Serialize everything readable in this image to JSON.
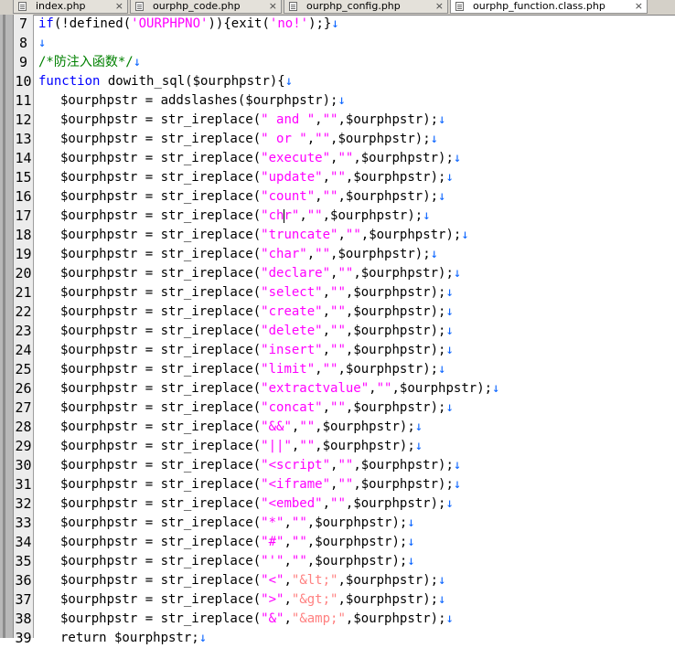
{
  "tabs": [
    {
      "label": "index.php",
      "active": false
    },
    {
      "label": "ourphp_code.php",
      "active": false
    },
    {
      "label": "ourphp_config.php",
      "active": false
    },
    {
      "label": "ourphp_function.class.php",
      "active": true
    }
  ],
  "tab_close_glyph": "×",
  "newline_glyph": "↓",
  "colors": {
    "keyword": "#0000ff",
    "string": "#ff00ff",
    "entity": "#ff8080",
    "comment": "#008000",
    "newline_marker": "#0a64ff"
  },
  "code": {
    "line7": {
      "num": "7",
      "p1": "if",
      "p2": "(!",
      "p3": "defined",
      "p4": "(",
      "p5": "'OURPHPNO'",
      "p6": ")){",
      "p7": "exit",
      "p8": "(",
      "p9": "'no!'",
      "p10": ");}"
    },
    "line8": {
      "num": "8"
    },
    "line9": {
      "num": "9",
      "comment": "/*防注入函数*/"
    },
    "line10": {
      "num": "10",
      "kw": "function",
      "rest": " dowith_sql($ourphpstr){"
    },
    "line11": {
      "num": "11",
      "pre": "$ourphpstr = addslashes($ourphpstr);"
    },
    "assign_prefix": "$ourphpstr = str_ireplace(",
    "empty_string": "\"\"",
    "var_arg": "$ourphpstr",
    "call_end": ");",
    "replacements": [
      {
        "num": "12",
        "search": "\" and \""
      },
      {
        "num": "13",
        "search": "\" or \""
      },
      {
        "num": "14",
        "search": "\"execute\""
      },
      {
        "num": "15",
        "search": "\"update\""
      },
      {
        "num": "16",
        "search": "\"count\""
      },
      {
        "num": "17",
        "search_a": "\"ch",
        "search_b": "r\""
      },
      {
        "num": "18",
        "search": "\"truncate\""
      },
      {
        "num": "19",
        "search": "\"char\""
      },
      {
        "num": "20",
        "search": "\"declare\""
      },
      {
        "num": "21",
        "search": "\"select\""
      },
      {
        "num": "22",
        "search": "\"create\""
      },
      {
        "num": "23",
        "search": "\"delete\""
      },
      {
        "num": "24",
        "search": "\"insert\""
      },
      {
        "num": "25",
        "search": "\"limit\""
      },
      {
        "num": "26",
        "search": "\"extractvalue\""
      },
      {
        "num": "27",
        "search": "\"concat\""
      },
      {
        "num": "28",
        "search": "\"&&\""
      },
      {
        "num": "29",
        "search": "\"||\""
      },
      {
        "num": "30",
        "search": "\"<script\""
      },
      {
        "num": "31",
        "search": "\"<iframe\""
      },
      {
        "num": "32",
        "search": "\"<embed\""
      },
      {
        "num": "33",
        "search": "\"*\""
      },
      {
        "num": "34",
        "search": "\"#\""
      },
      {
        "num": "35",
        "search": "\"'\""
      }
    ],
    "entity_replacements": [
      {
        "num": "36",
        "search": "\"<\"",
        "replace": "\"&lt;\""
      },
      {
        "num": "37",
        "search": "\">\"",
        "replace": "\"&gt;\""
      },
      {
        "num": "38",
        "search": "\"&\"",
        "replace": "\"&amp;\""
      }
    ],
    "line39": {
      "num": "39",
      "text": "return $ourphpstr;"
    }
  }
}
